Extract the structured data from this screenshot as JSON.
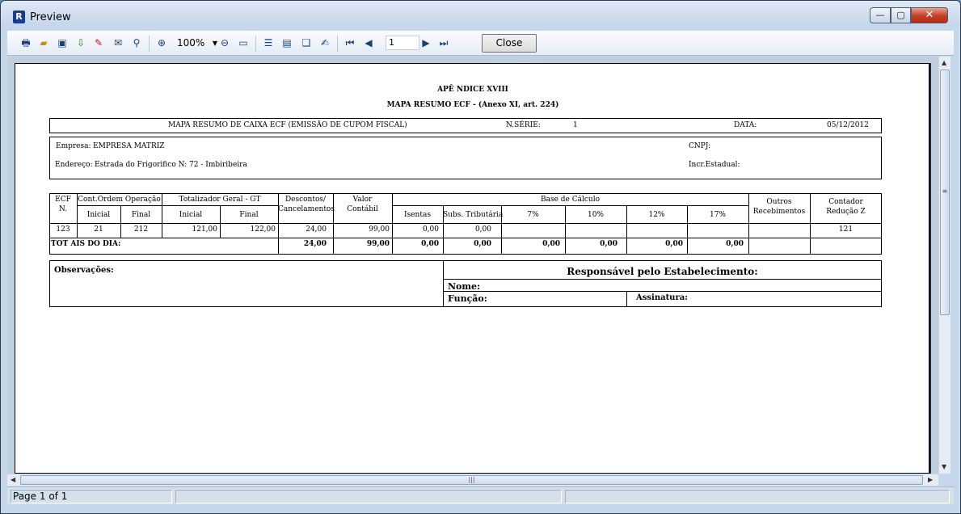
{
  "window": {
    "title": "Preview",
    "app_icon_glyph": "R",
    "controls": {
      "minimize": "—",
      "maximize": "▢",
      "close": "✕"
    }
  },
  "toolbar": {
    "icons": [
      "printer-icon",
      "open-folder-icon",
      "save-icon",
      "export-icon",
      "pdf-icon",
      "email-icon",
      "find-icon",
      "zoom-in-icon",
      "zoom-out-icon",
      "full-screen-icon",
      "outline-icon",
      "thumbnails-icon",
      "page-settings-icon",
      "edit-page-icon",
      "first-page-icon",
      "prev-page-icon",
      "next-page-icon",
      "last-page-icon"
    ],
    "zoom_value": "100%",
    "page_value": "1",
    "close_label": "Close"
  },
  "status": {
    "page_info": "Page 1 of 1"
  },
  "report": {
    "title1": "APÊ NDICE XVIII",
    "title2": "MAPA RESUMO ECF - (Anexo XI, art. 224)",
    "header": {
      "mapa_label": "MAPA RESUMO DE CAIXA ECF (EMISSÃO DE CUPOM FISCAL)",
      "nserie_label": "N.SÉRIE:",
      "nserie_value": "1",
      "data_label": "DATA:",
      "data_value": "05/12/2012"
    },
    "empresa": {
      "empresa_label": "Empresa:",
      "empresa_value": "EMPRESA MATRIZ",
      "cnpj_label": "CNPJ:",
      "endereco_label": "Endereço:",
      "endereco_value": "Estrada do Frigorifico  N: 72 - Imbiribeira",
      "insc_label": "Incr.Estadual:"
    },
    "table": {
      "h_ecf": "ECF",
      "h_ecf_n": "N.",
      "h_cont": "Cont.Ordem Operação",
      "h_cont_ini": "Inicial",
      "h_cont_fin": "Final",
      "h_tot": "Totalizador Geral - GT",
      "h_tot_ini": "Inicial",
      "h_tot_fin": "Final",
      "h_desc1": "Descontos/",
      "h_desc2": "Cancelamentos",
      "h_valor1": "Valor",
      "h_valor2": "Contábil",
      "h_base": "Base de Cálculo",
      "h_isentas": "Isentas",
      "h_subs": "Subs. Tributária",
      "h_7": "7%",
      "h_10": "10%",
      "h_12": "12%",
      "h_17": "17%",
      "h_outros1": "Outros",
      "h_outros2": "Recebimentos",
      "h_contador1": "Contador",
      "h_contador2": "Redução Z",
      "row": {
        "ecf": "123",
        "cont_ini": "21",
        "cont_fin": "212",
        "tot_ini": "121,00",
        "tot_fin": "122,00",
        "desc": "24,00",
        "valor": "99,00",
        "isentas": "0,00",
        "subs": "0,00",
        "contador": "121"
      },
      "totals_label": "TOT AIS DO DIA:",
      "totals": {
        "desc": "24,00",
        "valor": "99,00",
        "isentas": "0,00",
        "subs": "0,00",
        "p7": "0,00",
        "p10": "0,00",
        "p12": "0,00",
        "p17": "0,00"
      }
    },
    "footer": {
      "obs_label": "Observações:",
      "resp_label": "Responsável pelo Estabelecimento:",
      "nome_label": "Nome:",
      "funcao_label": "Função:",
      "assinatura_label": "Assinatura:"
    }
  }
}
